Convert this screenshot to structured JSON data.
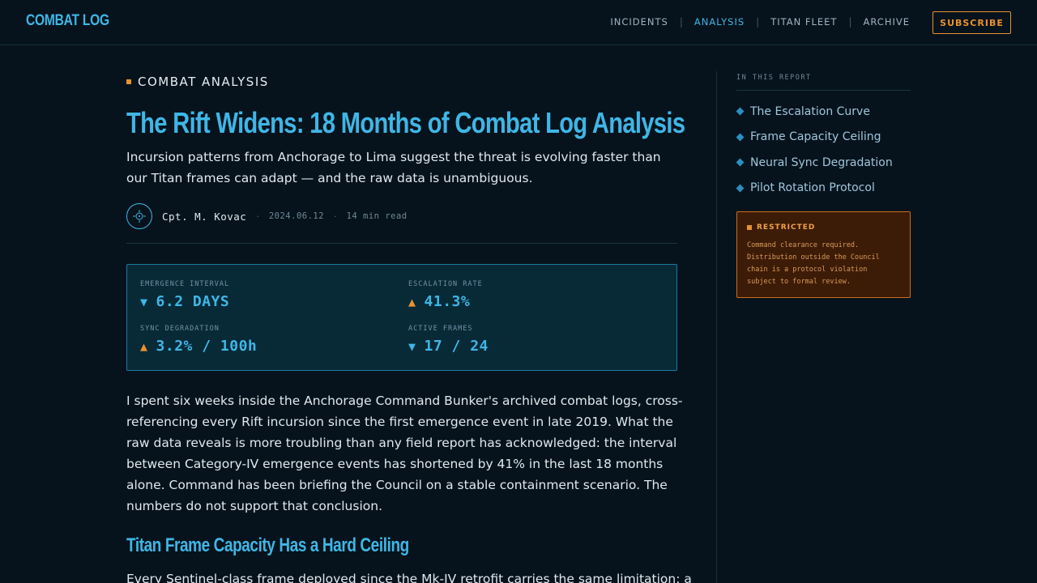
{
  "brand": "COMBAT LOG",
  "nav": {
    "items": [
      {
        "label": "INCIDENTS"
      },
      {
        "label": "ANALYSIS"
      },
      {
        "label": "TITAN FLEET"
      },
      {
        "label": "ARCHIVE"
      }
    ],
    "separator": "|",
    "subscribe_label": "SUBSCRIBE",
    "active": "ANALYSIS"
  },
  "article": {
    "kicker": "COMBAT ANALYSIS",
    "title": "The Rift Widens: 18 Months of Combat Log Analysis",
    "dek": "Incursion patterns from Anchorage to Lima suggest the threat is evolving faster than our Titan frames can adapt — and the raw data is unambiguous.",
    "author": "Cpt. M. Kovac",
    "date": "2024.06.12",
    "read_time": "14 min read",
    "meta_separator": "·",
    "stats": [
      {
        "label": "EMERGENCE INTERVAL",
        "direction": "down",
        "arrow": "▼",
        "value": "6.2 DAYS"
      },
      {
        "label": "ESCALATION RATE",
        "direction": "up",
        "arrow": "▲",
        "value": "41.3%"
      },
      {
        "label": "SYNC DEGRADATION",
        "direction": "up",
        "arrow": "▲",
        "value": "3.2% / 100h"
      },
      {
        "label": "ACTIVE FRAMES",
        "direction": "down",
        "arrow": "▼",
        "value": "17 / 24"
      }
    ],
    "paragraph_1": "I spent six weeks inside the Anchorage Command Bunker's archived combat logs, cross-referencing every Rift incursion since the first emergence event in late 2019. What the raw data reveals is more troubling than any field report has acknowledged: the interval between Category-IV emergence events has shortened by 41% in the last 18 months alone. Command has been briefing the Council on a stable containment scenario. The numbers do not support that conclusion.",
    "subhead": "Titan Frame Capacity Has a Hard Ceiling",
    "paragraph_2": "Every Sentinel-class frame deployed since the Mk-IV retrofit carries the same limitation: a"
  },
  "sidebar": {
    "toc_title": "IN THIS REPORT",
    "toc": [
      {
        "label": "The Escalation Curve"
      },
      {
        "label": "Frame Capacity Ceiling"
      },
      {
        "label": "Neural Sync Degradation"
      },
      {
        "label": "Pilot Rotation Protocol"
      }
    ],
    "restricted": {
      "title": "RESTRICTED",
      "body": "Command clearance required. Distribution outside the Council chain is a protocol violation subject to formal review."
    }
  },
  "colors": {
    "accent_cyan": "#3fb6e6",
    "accent_orange": "#e8912f",
    "background": "#07131c",
    "panel": "#082a37"
  }
}
